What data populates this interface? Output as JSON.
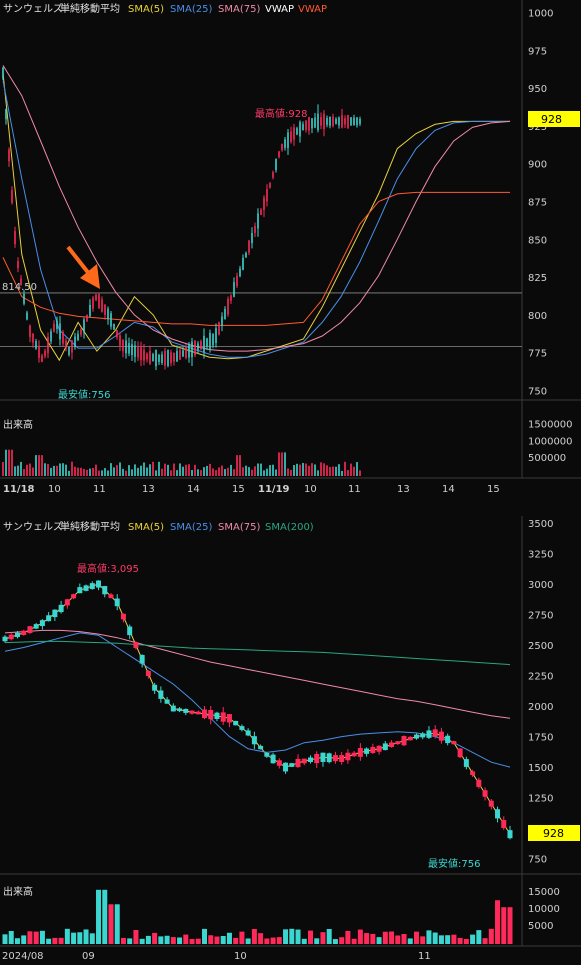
{
  "colors": {
    "background": "#0a0a0a",
    "grid": "#3a3a3a",
    "up_candle": "#3cd6d0",
    "down_candle": "#ff2a5a",
    "sma5": "#e8d23a",
    "sma25": "#4a8fe8",
    "sma75": "#f08aa8",
    "sma200": "#2aa585",
    "vwap_mark": "#ff5a30",
    "price_tag_bg": "#ffff00",
    "annotation_arrow": "#ff6a1a"
  },
  "top_chart": {
    "legend": {
      "name": "サンウェルズ",
      "indicator": "単純移動平均",
      "sma5": "SMA(5)",
      "sma25": "SMA(25)",
      "sma75": "SMA(75)",
      "vwap1": "VWAP",
      "vwap2": "VWAP"
    },
    "high_label": "最高値:928",
    "low_label": "最安値:756",
    "line_label": "814.50",
    "current_price": "928",
    "volume_title": "出来高"
  },
  "bottom_chart": {
    "legend": {
      "name": "サンウェルズ",
      "indicator": "単純移動平均",
      "sma5": "SMA(5)",
      "sma25": "SMA(25)",
      "sma75": "SMA(75)",
      "sma200": "SMA(200)"
    },
    "high_label": "最高値:3,095",
    "low_label": "最安値:756",
    "current_price": "928",
    "volume_title": "出来高"
  },
  "chart_data": [
    {
      "type": "line",
      "timeframe": "intraday 5-minute",
      "x_ticks": [
        "11/18",
        "10",
        "11",
        "13",
        "14",
        "15",
        "11/19",
        "10",
        "11",
        "13",
        "14",
        "15"
      ],
      "y_ticks": [
        750,
        775,
        800,
        825,
        850,
        875,
        900,
        925,
        950,
        975,
        1000
      ],
      "ylim": [
        745,
        1003
      ],
      "volume_ticks": [
        "500000",
        "1000000",
        "1500000"
      ],
      "volume_ylim": [
        0,
        1600000
      ],
      "horizontal_lines": [
        814.5,
        779
      ],
      "high": 928,
      "low": 756,
      "last": 928,
      "series": [
        {
          "name": "SMA(5)",
          "values": [
            960,
            840,
            790,
            770,
            795,
            776,
            790,
            812,
            800,
            780,
            776,
            772,
            771,
            772,
            776,
            780,
            784,
            805,
            830,
            855,
            880,
            910,
            920,
            926,
            928,
            928,
            928,
            928
          ]
        },
        {
          "name": "SMA(25)",
          "values": [
            955,
            890,
            830,
            790,
            778,
            778,
            786,
            795,
            792,
            782,
            778,
            774,
            772,
            772,
            774,
            778,
            782,
            795,
            812,
            835,
            862,
            890,
            910,
            922,
            927,
            928,
            928,
            928
          ]
        },
        {
          "name": "SMA(75)",
          "values": [
            965,
            945,
            915,
            885,
            858,
            835,
            815,
            800,
            790,
            784,
            780,
            777,
            776,
            776,
            777,
            779,
            781,
            786,
            795,
            808,
            826,
            850,
            875,
            898,
            915,
            924,
            927,
            928
          ]
        },
        {
          "name": "VWAP",
          "values": [
            838,
            812,
            805,
            801,
            799,
            798,
            797,
            796,
            795,
            794,
            794,
            793,
            793,
            793,
            793,
            794,
            795,
            810,
            835,
            860,
            875,
            880,
            881,
            881,
            881,
            881,
            881,
            881
          ]
        }
      ],
      "x": [
        0,
        0.2,
        0.4,
        0.6,
        0.9,
        1.1,
        1.3,
        1.5,
        1.8,
        2.2,
        2.6,
        3.0,
        3.4,
        3.8,
        4.2,
        4.6,
        5.0,
        5.2,
        5.4,
        5.6,
        5.8,
        6.1,
        6.4,
        6.8,
        7.4,
        8.0,
        8.8,
        9.6
      ]
    },
    {
      "type": "line",
      "timeframe": "daily",
      "x_ticks": [
        "2024/08",
        "09",
        "10",
        "11"
      ],
      "y_ticks": [
        750,
        1000,
        1250,
        1500,
        1750,
        2000,
        2250,
        2500,
        2750,
        3000,
        3250,
        3500
      ],
      "ylim": [
        640,
        3525
      ],
      "volume_ticks": [
        "5000",
        "10000",
        "15000"
      ],
      "volume_ylim": [
        0,
        17000
      ],
      "high": 3095,
      "low": 756,
      "last": 928,
      "series": [
        {
          "name": "SMA(5)",
          "values": [
            2550,
            2600,
            2680,
            2800,
            2950,
            3000,
            2850,
            2500,
            2150,
            1980,
            1950,
            1930,
            1900,
            1780,
            1600,
            1500,
            1550,
            1580,
            1570,
            1620,
            1650,
            1700,
            1750,
            1780,
            1700,
            1450,
            1200,
            950
          ]
        },
        {
          "name": "SMA(25)",
          "values": [
            2450,
            2480,
            2520,
            2560,
            2600,
            2580,
            2480,
            2380,
            2280,
            2180,
            2050,
            1900,
            1750,
            1650,
            1620,
            1640,
            1700,
            1720,
            1750,
            1770,
            1780,
            1790,
            1780,
            1750,
            1700,
            1620,
            1540,
            1500
          ]
        },
        {
          "name": "SMA(75)",
          "values": [
            2600,
            2610,
            2620,
            2620,
            2610,
            2590,
            2560,
            2520,
            2480,
            2440,
            2400,
            2360,
            2330,
            2300,
            2270,
            2240,
            2210,
            2180,
            2150,
            2120,
            2090,
            2060,
            2040,
            2010,
            1980,
            1950,
            1920,
            1900
          ]
        },
        {
          "name": "SMA(200)",
          "values": [
            2520,
            2525,
            2530,
            2530,
            2525,
            2520,
            2515,
            2505,
            2495,
            2485,
            2475,
            2470,
            2465,
            2460,
            2455,
            2450,
            2445,
            2440,
            2430,
            2420,
            2410,
            2400,
            2390,
            2380,
            2370,
            2360,
            2350,
            2340
          ]
        }
      ],
      "x": [
        "Aug-01",
        "Aug-08",
        "Aug-15",
        "Aug-22",
        "Aug-27",
        "Aug-30",
        "Sep-04",
        "Sep-09",
        "Sep-12",
        "Sep-17",
        "Sep-20",
        "Sep-25",
        "Sep-30",
        "Oct-03",
        "Oct-08",
        "Oct-11",
        "Oct-16",
        "Oct-21",
        "Oct-24",
        "Oct-29",
        "Nov-01",
        "Nov-06",
        "Nov-11",
        "Nov-14",
        "Nov-19",
        "Nov-22",
        "Nov-27",
        "Nov-29"
      ]
    }
  ]
}
